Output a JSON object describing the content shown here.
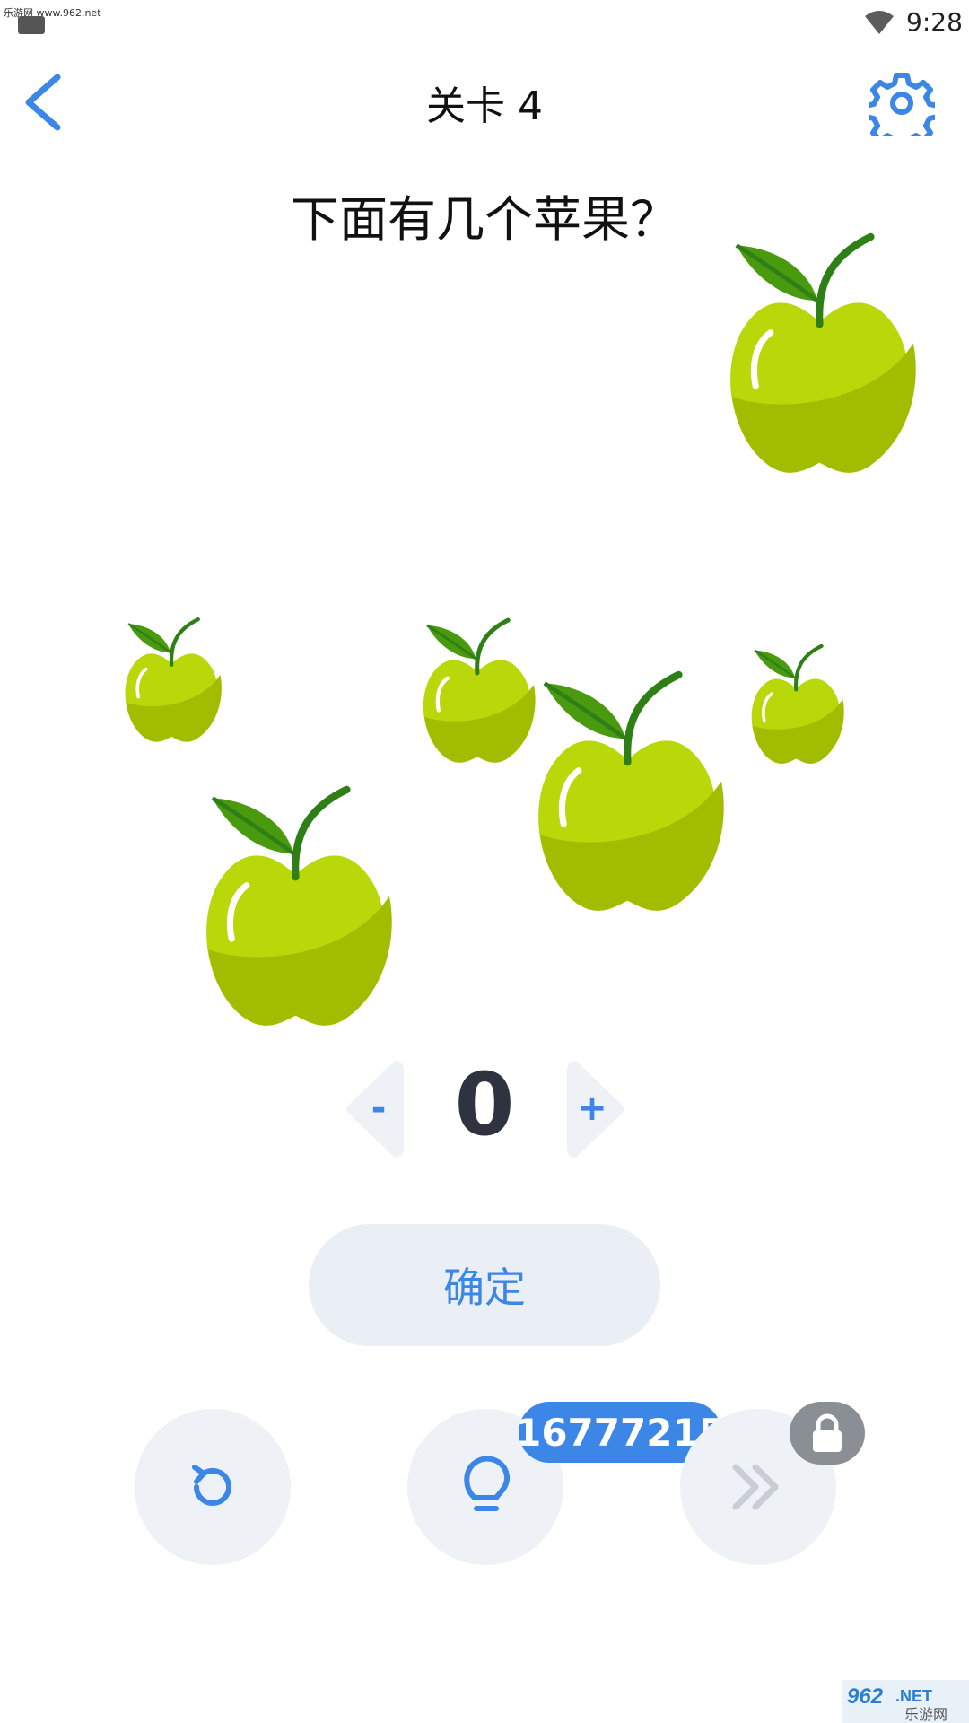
{
  "status": {
    "watermark": "乐游网 www.962.net",
    "time": "9:28"
  },
  "header": {
    "title": "关卡 4"
  },
  "question": "下面有几个苹果？",
  "stepper": {
    "minus_label": "-",
    "plus_label": "+",
    "value": "0"
  },
  "confirm_label": "确定",
  "toolbar": {
    "hint_count": "16777215"
  },
  "watermark_bottom": "962.NET 乐游网",
  "colors": {
    "accent": "#3b86e6",
    "button_bg": "#eaeef5",
    "apple_light": "#b9d80a",
    "apple_dark": "#a2bd00",
    "leaf": "#4a9a0f"
  }
}
